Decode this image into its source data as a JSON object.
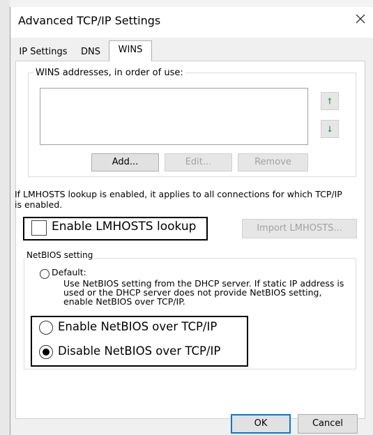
{
  "window": {
    "title": "Advanced TCP/IP Settings",
    "close_icon": "close-icon"
  },
  "tabs": [
    {
      "label": "IP Settings",
      "active": false
    },
    {
      "label": "DNS",
      "active": false
    },
    {
      "label": "WINS",
      "active": true
    }
  ],
  "wins": {
    "group_label": "WINS addresses, in order of use:",
    "addresses": [],
    "move_up_icon": "arrow-up-icon",
    "move_down_icon": "arrow-down-icon",
    "add_label": "Add...",
    "edit_label": "Edit...",
    "remove_label": "Remove"
  },
  "lmhosts": {
    "info": "If LMHOSTS lookup is enabled, it applies to all connections for which TCP/IP is enabled.",
    "checkbox_label": "Enable LMHOSTS lookup",
    "checked": false,
    "import_label": "Import LMHOSTS..."
  },
  "netbios": {
    "group_label": "NetBIOS setting",
    "default_label": "Default:",
    "default_description": "Use NetBIOS setting from the DHCP server. If static IP address is used or the DHCP server does not provide NetBIOS setting, enable NetBIOS over TCP/IP.",
    "enable_label": "Enable NetBIOS over TCP/IP",
    "disable_label": "Disable NetBIOS over TCP/IP",
    "selected": "disable"
  },
  "footer": {
    "ok_label": "OK",
    "cancel_label": "Cancel"
  },
  "colors": {
    "arrow_green": "#3fae5a",
    "focus_blue": "#0078d7",
    "highlight_box": "#000000"
  }
}
